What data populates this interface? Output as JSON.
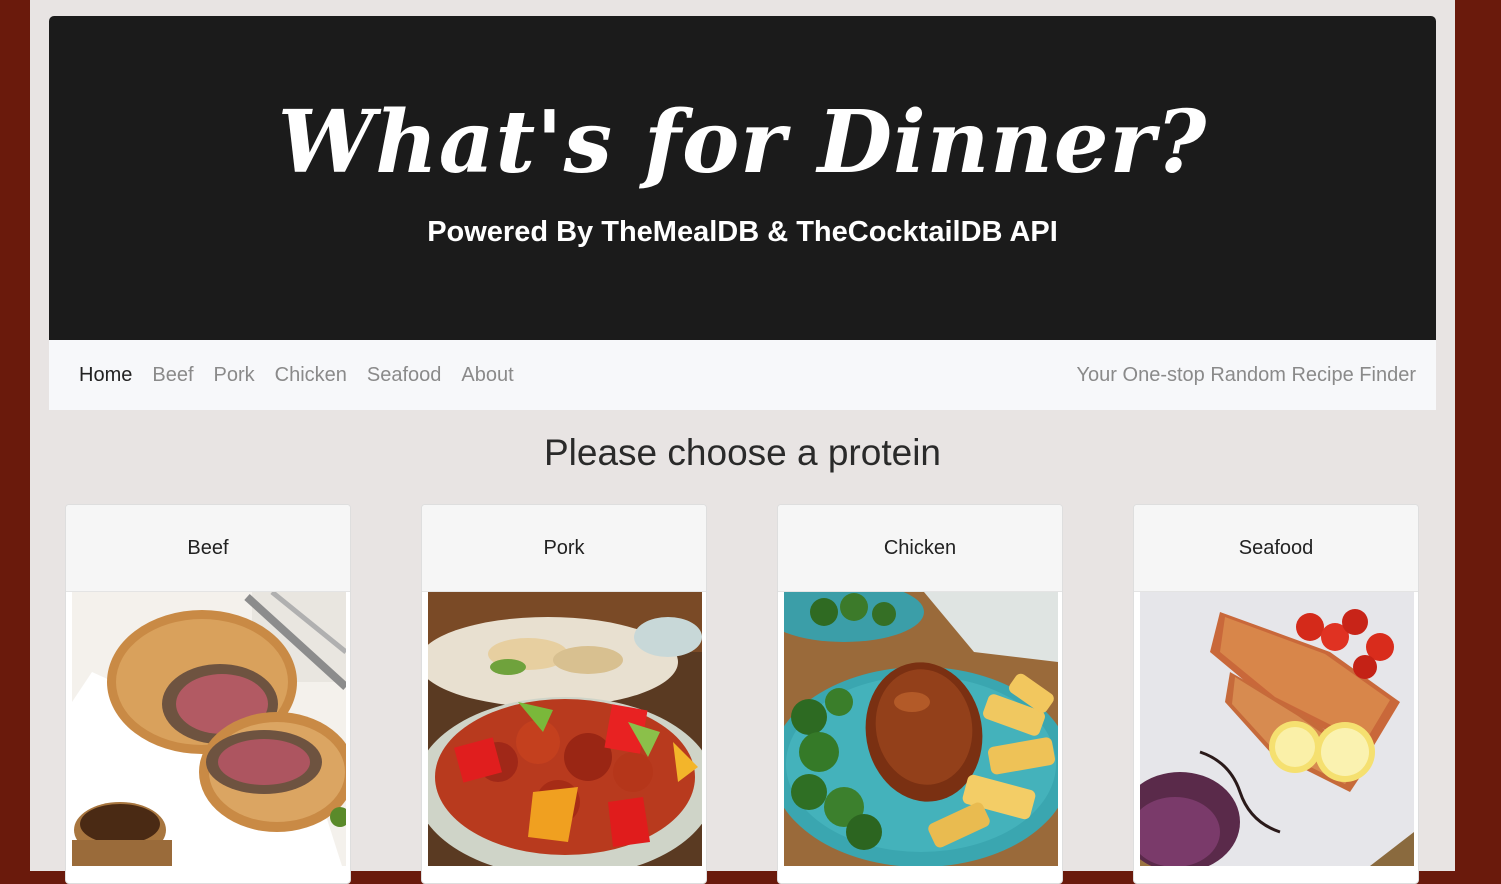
{
  "header": {
    "title": "What's for Dinner?",
    "subtitle": "Powered By TheMealDB & TheCocktailDB API"
  },
  "nav": {
    "links": [
      "Home",
      "Beef",
      "Pork",
      "Chicken",
      "Seafood",
      "About"
    ],
    "active": "Home",
    "tagline": "Your One-stop Random Recipe Finder"
  },
  "main": {
    "heading": "Please choose a protein",
    "cards": [
      {
        "label": "Beef",
        "image": "beef-wellington-image"
      },
      {
        "label": "Pork",
        "image": "sweet-and-sour-pork-image"
      },
      {
        "label": "Chicken",
        "image": "glazed-chicken-image"
      },
      {
        "label": "Seafood",
        "image": "baked-salmon-image"
      }
    ]
  },
  "colors": {
    "outer_background": "#6a1a0c",
    "page_background": "#e8e4e3",
    "jumbotron": "#1b1b1b",
    "navbar": "#f7f8fa"
  }
}
